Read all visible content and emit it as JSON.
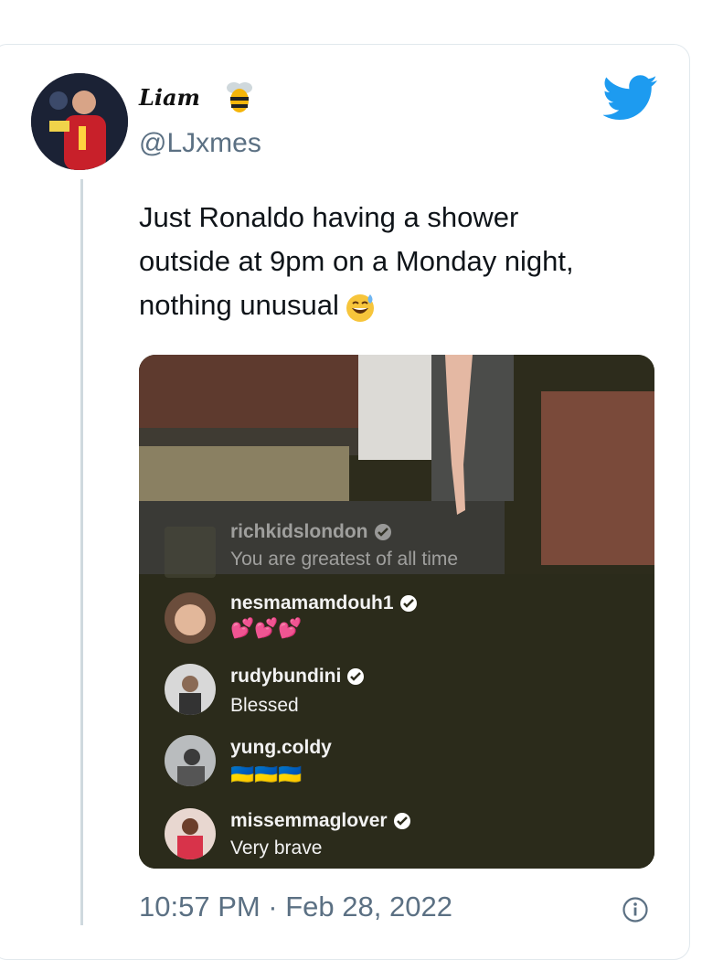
{
  "tweet": {
    "author_name": "Liam",
    "handle": "@LJxmes",
    "text_lines": [
      "Just Ronaldo having a shower",
      "outside at 9pm on a Monday night,",
      "nothing unusual"
    ],
    "timestamp": "10:57 PM · Feb 28, 2022"
  },
  "media": {
    "comments": [
      {
        "user": "richkidslondon",
        "text": "You are greatest of all time",
        "verified": true
      },
      {
        "user": "nesmamamdouh1",
        "text": "💕💕💕",
        "verified": true
      },
      {
        "user": "rudybundini",
        "text": "Blessed",
        "verified": true
      },
      {
        "user": "yung.coldy",
        "text": "🇺🇦🇺🇦🇺🇦",
        "verified": false
      },
      {
        "user": "missemmaglover",
        "text": "Very brave",
        "verified": true
      }
    ]
  },
  "icons": {
    "brand": "twitter-bird-icon",
    "emoji": "grinning-sweat-emoji-icon",
    "info": "info-icon",
    "bee": "bee-emoji-icon"
  },
  "colors": {
    "twitter_blue": "#1d9bf0",
    "handle_gray": "#5b7083",
    "text": "#0f1419"
  }
}
